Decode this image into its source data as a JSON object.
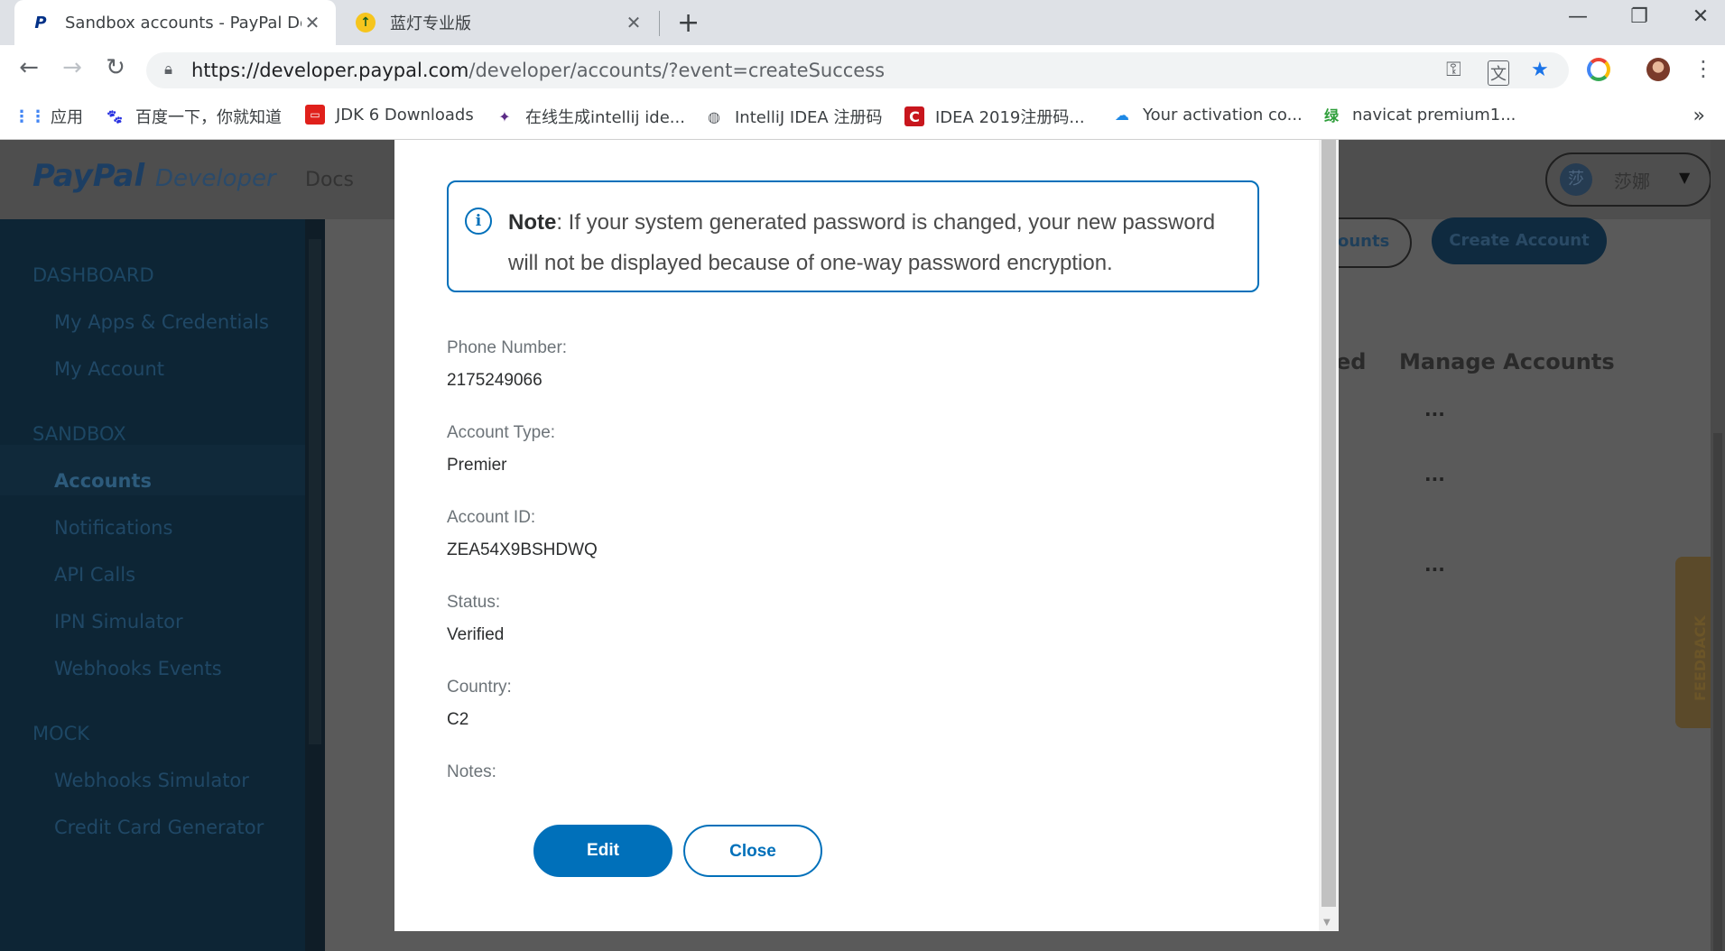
{
  "browser": {
    "tabs": [
      {
        "title": "Sandbox accounts - PayPal De",
        "favicon": "P"
      },
      {
        "title": "蓝灯专业版",
        "favicon": "↑"
      }
    ],
    "new_tab": "+",
    "window": {
      "minimize": "—",
      "restore": "❐",
      "close": "✕"
    },
    "url_host": "https://developer.paypal.com",
    "url_path": "/developer/accounts/?event=createSuccess",
    "bookmarks": [
      {
        "label": "应用",
        "icon": "apps-grid-icon"
      },
      {
        "label": "百度一下，你就知道",
        "icon": "baidu-paw-icon"
      },
      {
        "label": "JDK 6 Downloads",
        "icon": "oracle-icon"
      },
      {
        "label": "在线生成intellij ide...",
        "icon": "sparkle-icon"
      },
      {
        "label": "IntelliJ IDEA 注册码",
        "icon": "globe-icon"
      },
      {
        "label": "IDEA 2019注册码...",
        "icon": "c-logo-icon"
      },
      {
        "label": "Your activation co...",
        "icon": "cloud-icon"
      },
      {
        "label": "navicat premium1...",
        "icon": "green-char-icon"
      }
    ],
    "bookmark_char": "绿",
    "bookmarks_more": "»"
  },
  "background_page": {
    "logo": "PayPal",
    "logo_suffix": "Developer",
    "nav_docs": "Docs",
    "user_initial": "莎",
    "user_name": "莎娜",
    "sidebar": {
      "sections": [
        "DASHBOARD",
        "SANDBOX",
        "MOCK"
      ],
      "dashboard_items": [
        "My Apps & Credentials",
        "My Account"
      ],
      "sandbox_items": [
        "Accounts",
        "Notifications",
        "API Calls",
        "IPN Simulator",
        "Webhooks Events"
      ],
      "mock_items": [
        "Webhooks Simulator",
        "Credit Card Generator"
      ]
    },
    "btn_accounts": "ounts",
    "btn_create": "Create Account",
    "col_partial": "ed",
    "col_manage": "Manage Accounts",
    "dots": "···",
    "feedback": "FEEDBACK"
  },
  "modal": {
    "note_bold": "Note",
    "note_text": ": If your system generated password is changed, your new password will not be displayed because of one-way password encryption.",
    "fields": [
      {
        "label": "Phone Number:",
        "value": "2175249066"
      },
      {
        "label": "Account Type:",
        "value": "Premier"
      },
      {
        "label": "Account ID:",
        "value": "ZEA54X9BSHDWQ"
      },
      {
        "label": "Status:",
        "value": "Verified"
      },
      {
        "label": "Country:",
        "value": "C2"
      },
      {
        "label": "Notes:",
        "value": ""
      }
    ],
    "edit_label": "Edit",
    "close_label": "Close"
  }
}
